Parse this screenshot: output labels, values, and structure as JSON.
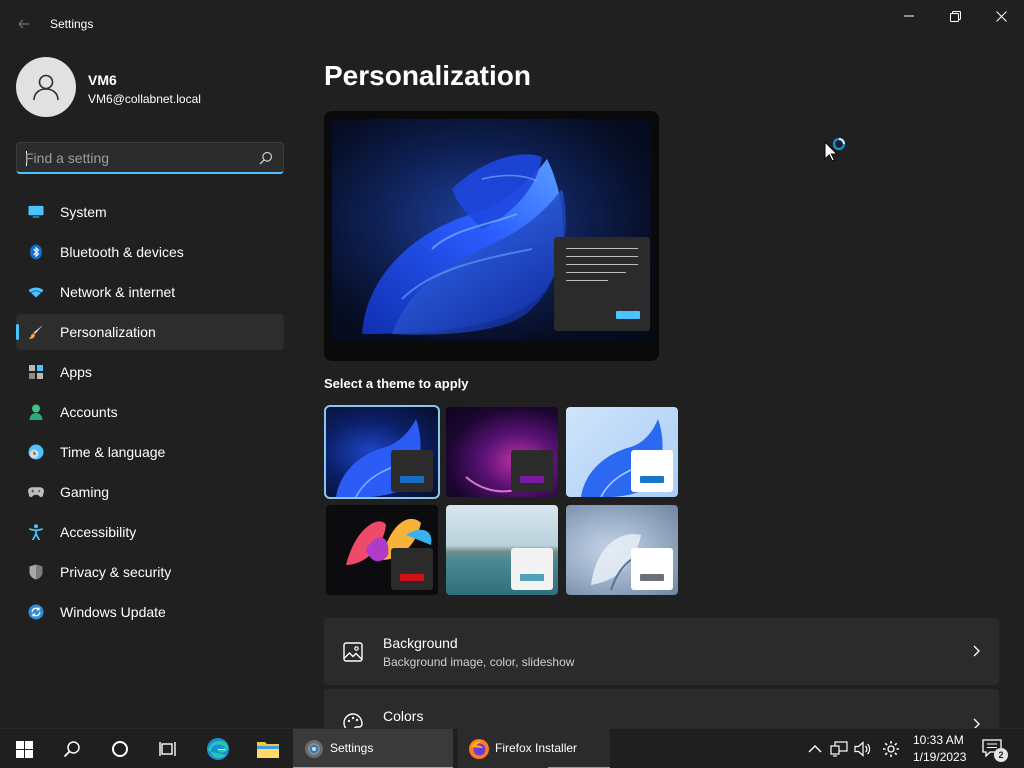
{
  "window": {
    "title": "Settings",
    "back_icon": "back-arrow-icon",
    "controls": [
      "minimize-icon",
      "restore-icon",
      "close-icon"
    ]
  },
  "profile": {
    "name": "VM6",
    "email": "VM6@collabnet.local"
  },
  "search": {
    "placeholder": "Find a setting",
    "value": ""
  },
  "nav": {
    "items": [
      {
        "label": "System",
        "icon": "system-display-icon",
        "active": false
      },
      {
        "label": "Bluetooth & devices",
        "icon": "bluetooth-icon",
        "active": false
      },
      {
        "label": "Network & internet",
        "icon": "wifi-icon",
        "active": false
      },
      {
        "label": "Personalization",
        "icon": "paintbrush-icon",
        "active": true
      },
      {
        "label": "Apps",
        "icon": "apps-icon",
        "active": false
      },
      {
        "label": "Accounts",
        "icon": "accounts-icon",
        "active": false
      },
      {
        "label": "Time & language",
        "icon": "clock-globe-icon",
        "active": false
      },
      {
        "label": "Gaming",
        "icon": "gamepad-icon",
        "active": false
      },
      {
        "label": "Accessibility",
        "icon": "accessibility-icon",
        "active": false
      },
      {
        "label": "Privacy & security",
        "icon": "shield-icon",
        "active": false
      },
      {
        "label": "Windows Update",
        "icon": "windows-update-icon",
        "active": false
      }
    ]
  },
  "main": {
    "title": "Personalization",
    "themes_heading": "Select a theme to apply",
    "themes": [
      {
        "name": "windows-dark-bloom",
        "selected": true,
        "accent": "#1a6dc4"
      },
      {
        "name": "glow",
        "selected": false,
        "accent": "#7a1aa0"
      },
      {
        "name": "windows-light-bloom",
        "selected": false,
        "accent": "#1a76c8"
      },
      {
        "name": "captured-motion",
        "selected": false,
        "accent": "#d01019"
      },
      {
        "name": "sunrise",
        "selected": false,
        "accent": "#4ea1b8"
      },
      {
        "name": "flow",
        "selected": false,
        "accent": "#6b6f78"
      }
    ],
    "cards": [
      {
        "title": "Background",
        "subtitle": "Background image, color, slideshow",
        "icon": "image-icon"
      },
      {
        "title": "Colors",
        "subtitle": "",
        "icon": "palette-icon"
      }
    ]
  },
  "taskbar": {
    "icons": [
      "windows-start-icon",
      "search-icon",
      "cortana-icon",
      "task-view-icon",
      "edge-icon",
      "file-explorer-icon"
    ],
    "apps": [
      {
        "label": "Settings",
        "icon": "settings-gear-icon",
        "active": true
      },
      {
        "label": "Firefox Installer",
        "icon": "firefox-icon",
        "active": false
      }
    ],
    "tray_icons": [
      "chevron-up-icon",
      "network-icon",
      "volume-icon",
      "settings-gear-icon"
    ],
    "time": "10:33 AM",
    "date": "1/19/2023",
    "notification_count": "2"
  },
  "colors": {
    "accent": "#4cc2ff",
    "background": "#202020",
    "card": "#2b2b2b",
    "taskbar": "#1f1f1f"
  }
}
